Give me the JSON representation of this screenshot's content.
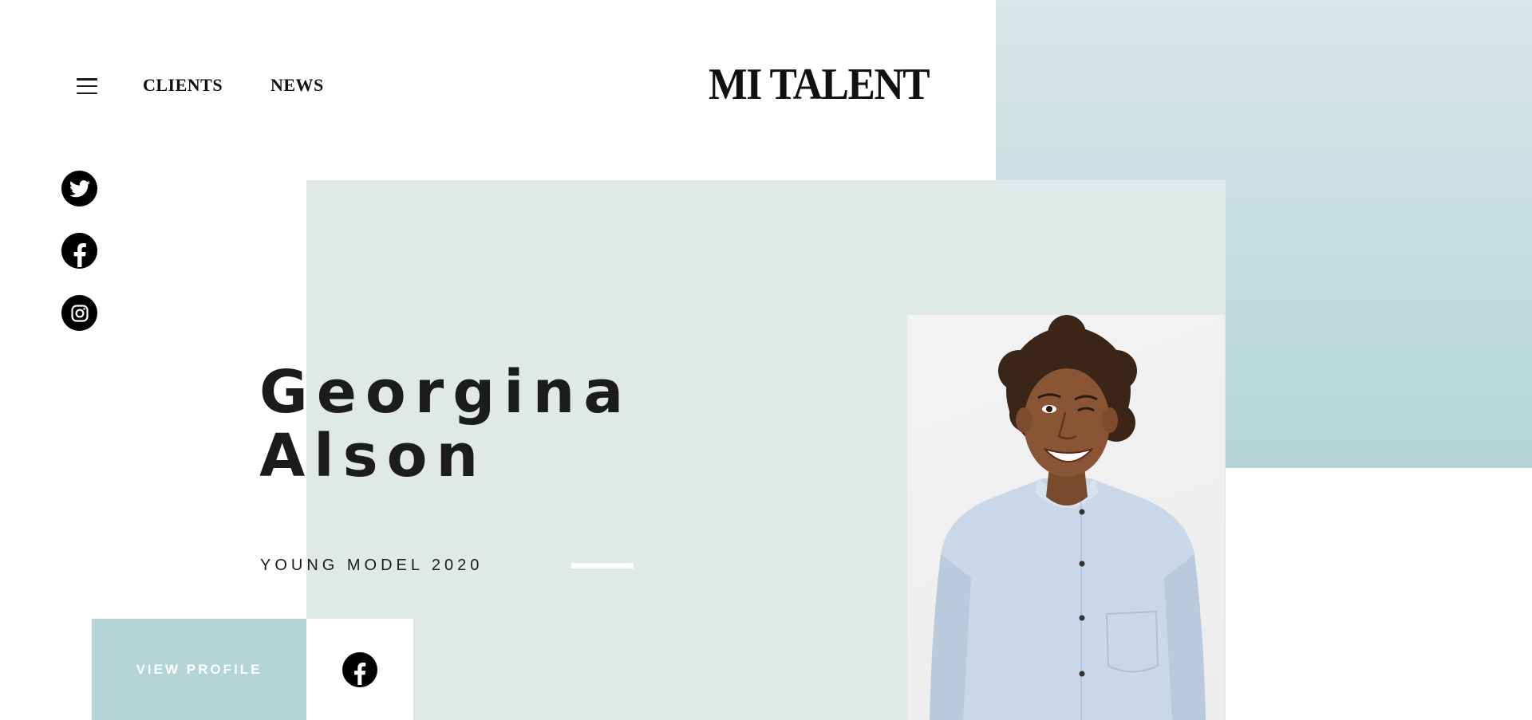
{
  "header": {
    "nav": {
      "clients_label": "CLIENTS",
      "news_label": "NEWS"
    },
    "logo_text": "MI TALENT"
  },
  "social": {
    "icons": [
      "twitter-icon",
      "facebook-icon",
      "instagram-icon"
    ]
  },
  "hero": {
    "first_name": "Georgina",
    "last_name": "Alson",
    "subtitle": "YOUNG MODEL 2020"
  },
  "actions": {
    "view_profile_label": "VIEW PROFILE",
    "share_icon": "facebook-icon"
  },
  "colors": {
    "accent_teal": "#b3d5d6",
    "panel_grey": "#e1e8e8",
    "text_dark": "#1c1c1e"
  }
}
